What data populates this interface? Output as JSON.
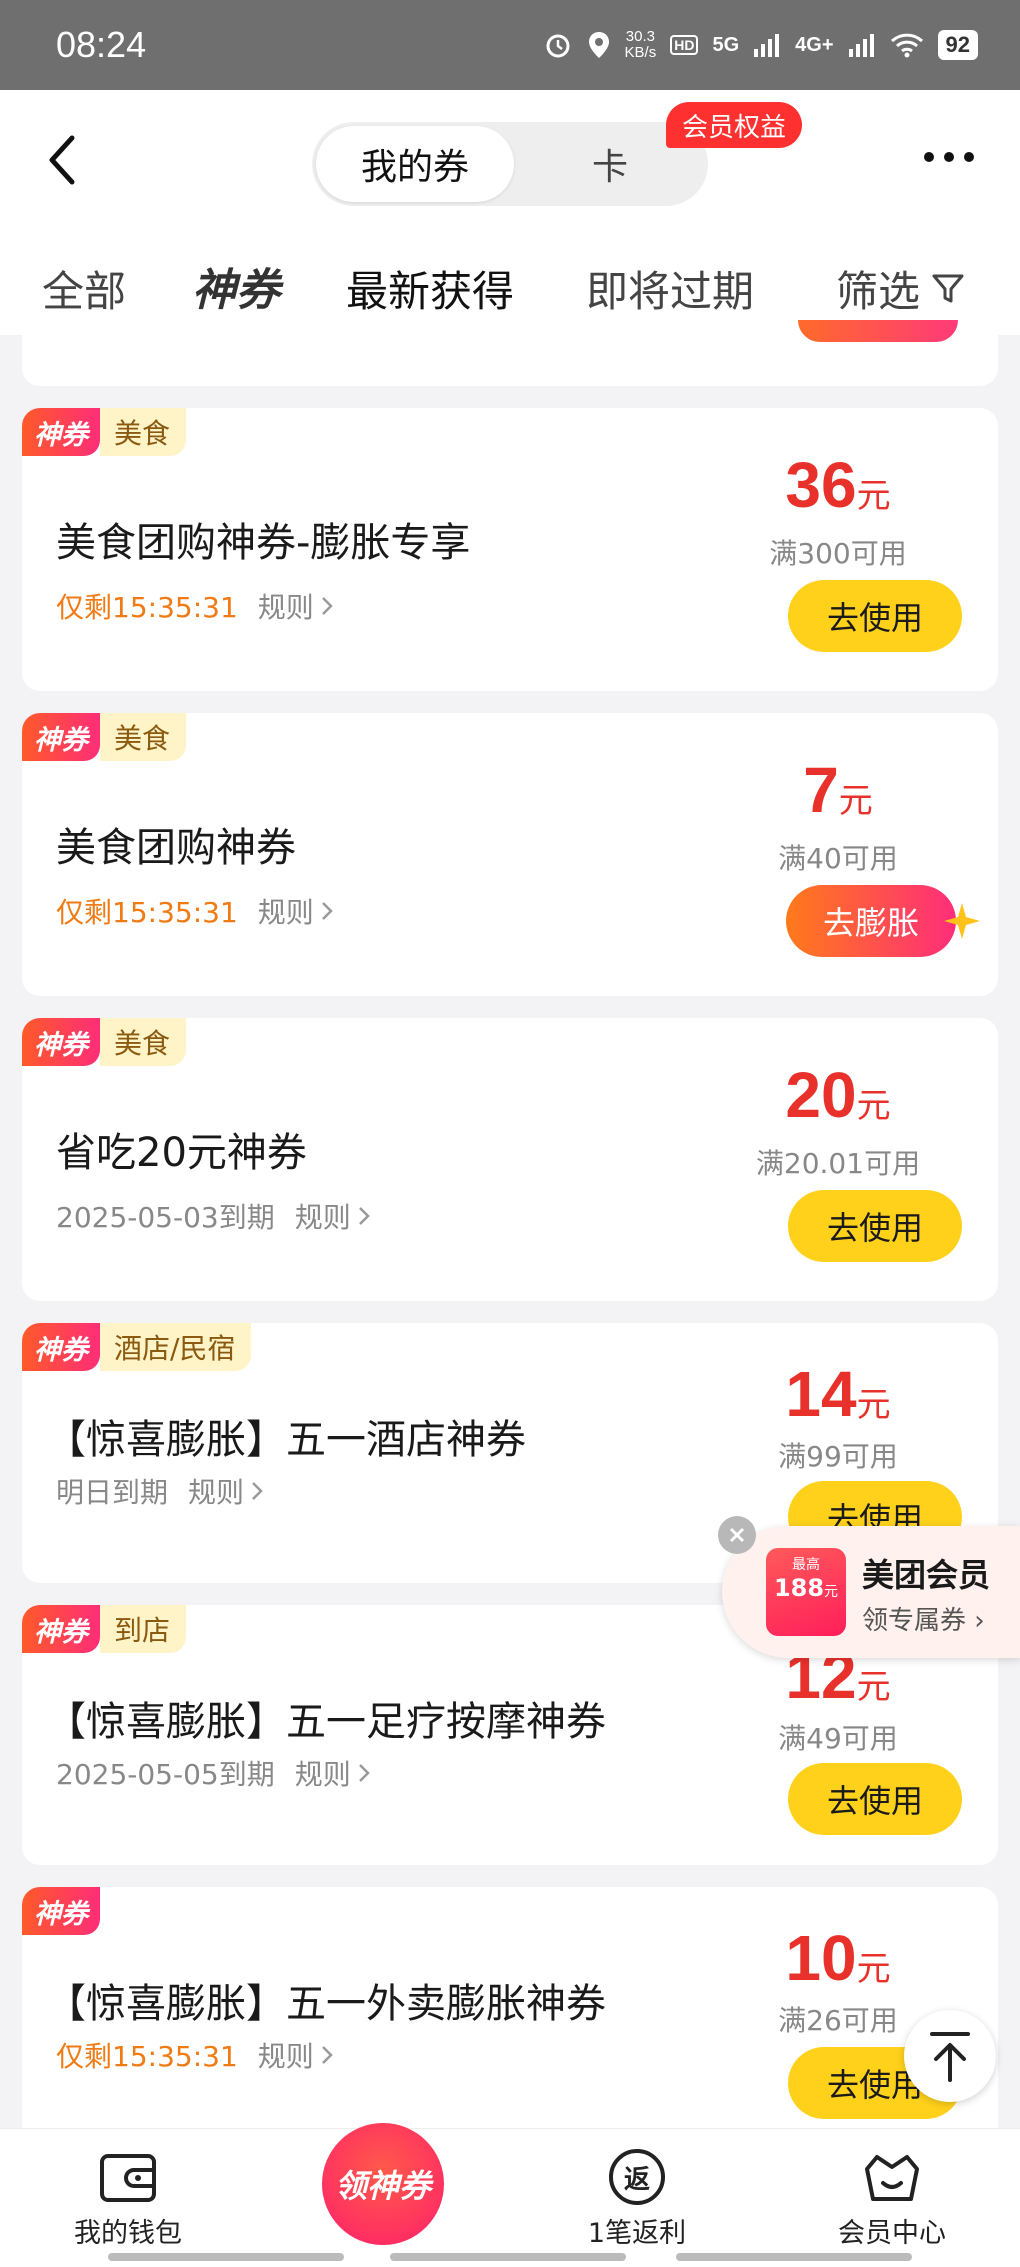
{
  "status_bar": {
    "time": "08:24",
    "speed_value": "30.3",
    "speed_unit": "KB/s",
    "network_5g": "5G",
    "network_4g": "4G+",
    "battery": "92"
  },
  "header": {
    "segment_my_coupons": "我的券",
    "segment_card": "卡",
    "member_badge": "会员权益"
  },
  "tabs": {
    "all": "全部",
    "god": "神券",
    "newest": "最新获得",
    "expiring": "即将过期",
    "filter": "筛选"
  },
  "coupons": [
    {
      "tag": "神券",
      "category": "美食",
      "title": "美食团购神券-膨胀专享",
      "validity": "仅剩15:35:31",
      "rule": "规则",
      "amount": "36",
      "unit": "元",
      "condition": "满300可用",
      "button": "去使用"
    },
    {
      "tag": "神券",
      "category": "美食",
      "title": "美食团购神券",
      "validity": "仅剩15:35:31",
      "rule": "规则",
      "amount": "7",
      "unit": "元",
      "condition": "满40可用",
      "button": "去膨胀"
    },
    {
      "tag": "神券",
      "category": "美食",
      "title": "省吃20元神券",
      "validity": "2025-05-03到期",
      "rule": "规则",
      "amount": "20",
      "unit": "元",
      "condition": "满20.01可用",
      "button": "去使用"
    },
    {
      "tag": "神券",
      "category": "酒店/民宿",
      "title": "【惊喜膨胀】五一酒店神券",
      "validity": "明日到期",
      "rule": "规则",
      "amount": "14",
      "unit": "元",
      "condition": "满99可用",
      "button": "去使用"
    },
    {
      "tag": "神券",
      "category": "到店",
      "title": "【惊喜膨胀】五一足疗按摩神券",
      "validity": "2025-05-05到期",
      "rule": "规则",
      "amount": "12",
      "unit": "元",
      "condition": "满49可用",
      "button": "去使用"
    },
    {
      "tag": "神券",
      "category": "",
      "title": "【惊喜膨胀】五一外卖膨胀神券",
      "validity": "仅剩15:35:31",
      "rule": "规则",
      "amount": "10",
      "unit": "元",
      "condition": "满26可用",
      "button": "去使用"
    }
  ],
  "promo": {
    "box_small": "最高",
    "box_amount": "188",
    "box_unit": "元",
    "title": "美团会员",
    "subtitle": "领专属券 ›"
  },
  "bottom_nav": {
    "wallet": "我的钱包",
    "center": "领神券",
    "rebate_icon": "返",
    "rebate": "1笔返利",
    "member": "会员中心"
  },
  "colors": {
    "accent_yellow": "#ffd11a",
    "price_red": "#e8312a",
    "urgent_orange": "#f07b14"
  }
}
